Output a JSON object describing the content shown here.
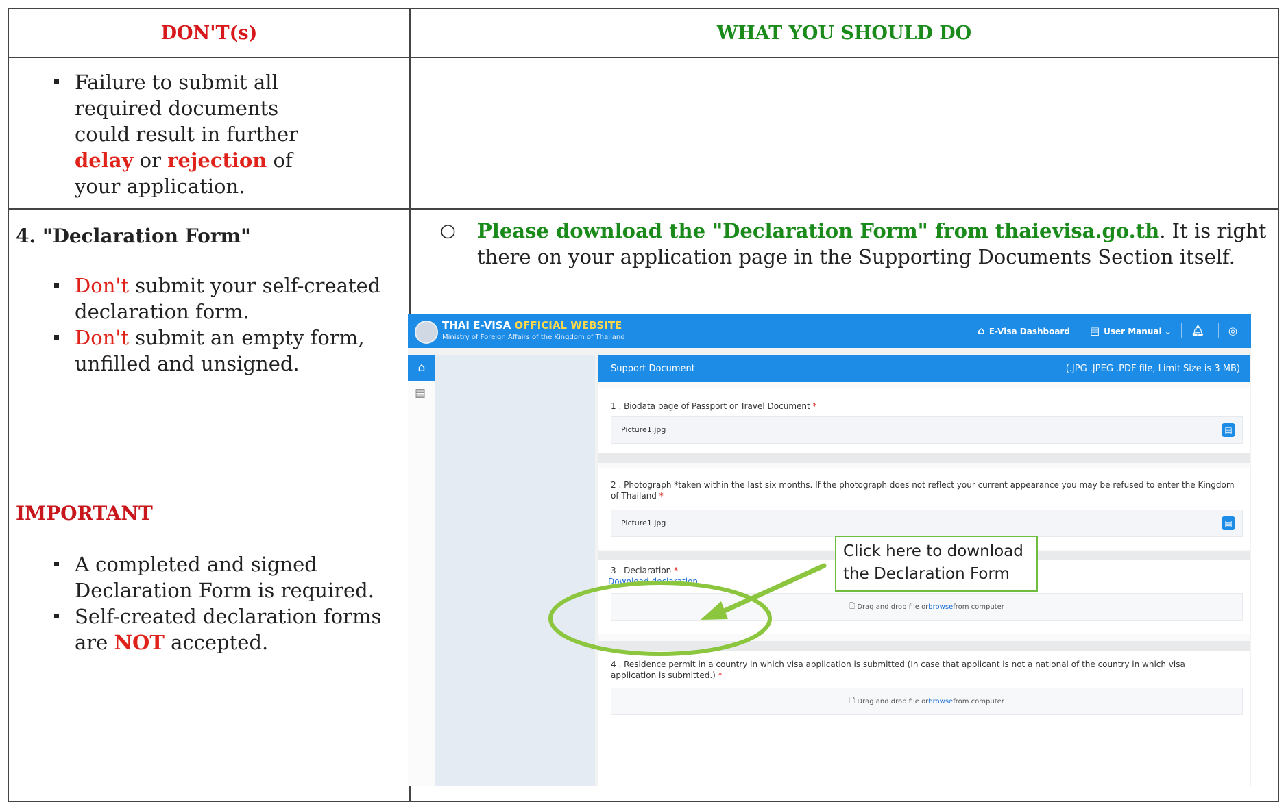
{
  "header": {
    "left": "DON'T(s)",
    "right": "WHAT YOU SHOULD DO"
  },
  "row1": {
    "item_pre": "Failure to submit all required documents could result in further ",
    "delay": "delay",
    "or": " or ",
    "rejection": "rejection",
    "item_post": " of your application."
  },
  "row2": {
    "heading": "4. \"Declaration Form\"",
    "donts": [
      {
        "red": "Don't",
        "rest": " submit your self-created declaration form."
      },
      {
        "red": "Don't",
        "rest": " submit an empty form, unfilled and unsigned."
      }
    ],
    "important_title": "IMPORTANT",
    "important_items": [
      {
        "text": "A completed and signed Declaration Form is required."
      },
      {
        "pre": "Self-created declaration forms are ",
        "bold": "NOT",
        "post": " accepted."
      }
    ],
    "instruction_green": "Please download the \"Declaration Form\" from thaievisa.go.th",
    "instruction_rest": ". It is right there on your application page in the Supporting Documents Section itself."
  },
  "screenshot": {
    "brand_white": "THAI E-VISA ",
    "brand_yellow": "OFFICIAL WEBSITE",
    "ministry": "Ministry of Foreign Affairs of the Kingdom of Thailand",
    "nav": {
      "dashboard": "E-Visa Dashboard",
      "manual": "User Manual"
    },
    "panel_title": "Support Document",
    "panel_note": "(.JPG .JPEG .PDF file, Limit Size is 3 MB)",
    "sections": {
      "s1_label": "1 . Biodata page of Passport or Travel Document",
      "s1_file": "Picture1.jpg",
      "s2_label": "2 . Photograph *taken within the last six months. If the photograph does not reflect your current appearance you may be refused to enter the Kingdom of Thailand",
      "s2_file": "Picture1.jpg",
      "s3_label": "3 . Declaration",
      "s3_link": "Download declaration",
      "drop_pre": "Drag and drop file or ",
      "drop_link": "browse",
      "drop_post": " from computer",
      "s4_label": "4 . Residence permit in a country in which visa application is submitted (In case that applicant is not a national of the country in which visa application is submitted.)"
    },
    "required_mark": "*",
    "callout": "Click here to download the Declaration Form"
  },
  "colors": {
    "header_red": "#d7191c",
    "header_green": "#1a8a1a",
    "site_blue": "#1c8ce6",
    "annotation_green": "#6fbd3e"
  }
}
